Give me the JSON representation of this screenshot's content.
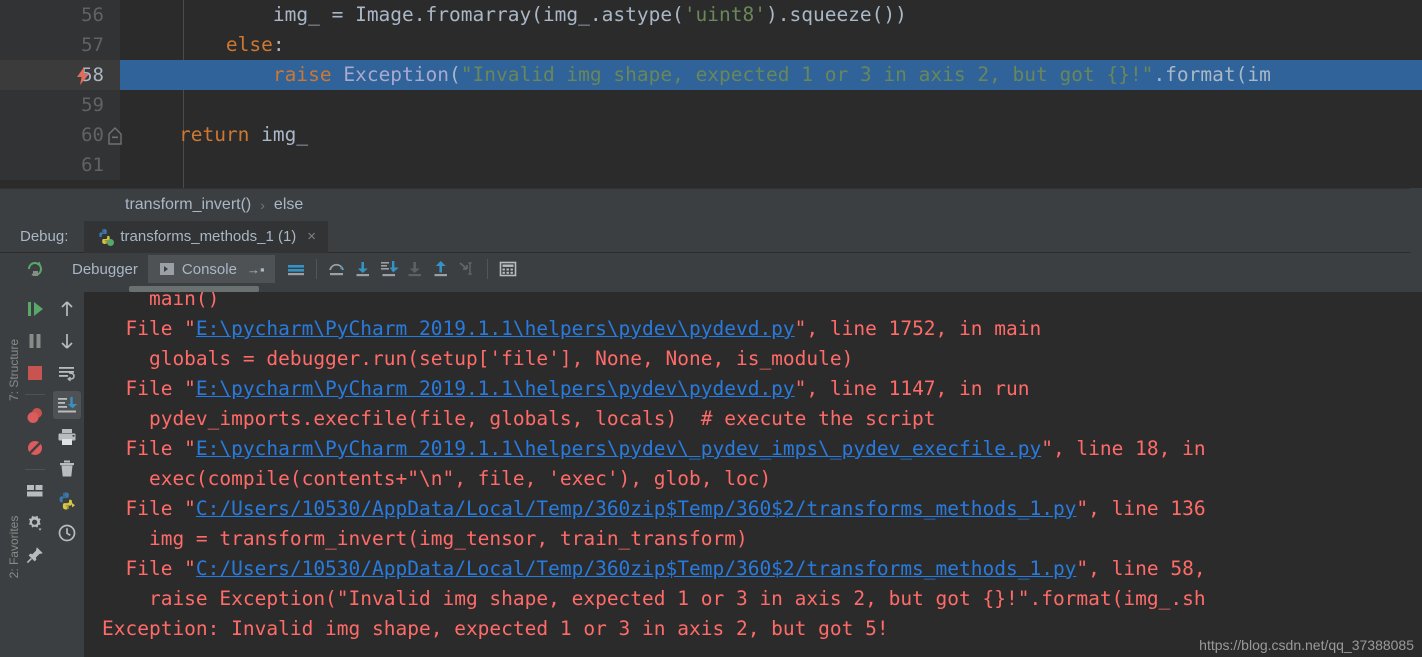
{
  "editor": {
    "lines": [
      {
        "num": "56",
        "marker": "",
        "fold": false,
        "selected": false,
        "tokens": [
          {
            "t": "            ",
            "c": "pln"
          },
          {
            "t": "img_ ",
            "c": "pln"
          },
          {
            "t": "= ",
            "c": "pln"
          },
          {
            "t": "Image.fromarray(img_.astype(",
            "c": "pln"
          },
          {
            "t": "'uint8'",
            "c": "str"
          },
          {
            "t": ").squeeze())",
            "c": "pln"
          }
        ]
      },
      {
        "num": "57",
        "marker": "",
        "fold": false,
        "selected": false,
        "tokens": [
          {
            "t": "        ",
            "c": "pln"
          },
          {
            "t": "else",
            "c": "kw"
          },
          {
            "t": ":",
            "c": "pln"
          }
        ]
      },
      {
        "num": "58",
        "marker": "exception-breakpoint",
        "fold": false,
        "selected": true,
        "tokens": [
          {
            "t": "            ",
            "c": "pln"
          },
          {
            "t": "raise ",
            "c": "kw"
          },
          {
            "t": "Exception",
            "c": "cls"
          },
          {
            "t": "(",
            "c": "pln"
          },
          {
            "t": "\"Invalid img shape, expected 1 or 3 in axis 2, but got {}!\"",
            "c": "str"
          },
          {
            "t": ".format(im",
            "c": "pln"
          }
        ]
      },
      {
        "num": "59",
        "marker": "",
        "fold": false,
        "selected": false,
        "tokens": []
      },
      {
        "num": "60",
        "marker": "",
        "fold": true,
        "selected": false,
        "tokens": [
          {
            "t": "    ",
            "c": "pln"
          },
          {
            "t": "return ",
            "c": "kw"
          },
          {
            "t": "img_",
            "c": "pln"
          }
        ]
      },
      {
        "num": "61",
        "marker": "",
        "fold": false,
        "selected": false,
        "tokens": []
      }
    ]
  },
  "breadcrumb": {
    "items": [
      "transform_invert()",
      "else"
    ],
    "separator": "›"
  },
  "debug_tabbar": {
    "label": "Debug:",
    "tab_title": "transforms_methods_1 (1)",
    "close_glyph": "×",
    "python_icon": "python-icon"
  },
  "debug_toolbar": {
    "rerun_icon": "rerun-icon",
    "tabs": [
      {
        "label": "Debugger",
        "active": false,
        "icon": ""
      },
      {
        "label": "Console",
        "active": true,
        "icon": "console-icon"
      }
    ],
    "console_pin_glyph": "→▪",
    "buttons": [
      {
        "name": "show-execution-point-icon",
        "enabled": true
      },
      {
        "name": "step-over-icon",
        "enabled": true
      },
      {
        "name": "step-into-icon",
        "enabled": true
      },
      {
        "name": "step-into-my-code-icon",
        "enabled": true
      },
      {
        "name": "force-step-into-icon",
        "enabled": false
      },
      {
        "name": "step-out-icon",
        "enabled": true
      },
      {
        "name": "run-to-cursor-icon",
        "enabled": false
      },
      {
        "name": "evaluate-expression-icon",
        "enabled": true
      }
    ]
  },
  "left_rail_labels": [
    "7: Structure",
    "2: Favorites"
  ],
  "debug_actions": [
    {
      "name": "resume-program-icon",
      "color": "#4f9e4f",
      "active": false
    },
    {
      "name": "pause-program-icon",
      "color": "#888888",
      "active": false
    },
    {
      "name": "stop-program-icon",
      "color": "#c75450",
      "active": false
    },
    {
      "name": "view-breakpoints-icon",
      "color": "#db5c5c",
      "active": false
    },
    {
      "name": "mute-breakpoints-icon",
      "color": "#db5c5c",
      "active": false
    },
    {
      "name": "restore-layout-icon",
      "color": "#a9b7c6",
      "active": false
    },
    {
      "name": "settings-gear-icon",
      "color": "#a9b7c6",
      "active": false
    },
    {
      "name": "pin-tab-icon",
      "color": "#a9b7c6",
      "active": false
    }
  ],
  "console_actions": [
    {
      "name": "up-the-stack-icon",
      "active": false
    },
    {
      "name": "down-the-stack-icon",
      "active": false
    },
    {
      "name": "use-soft-wraps-icon",
      "active": false
    },
    {
      "name": "scroll-to-end-icon",
      "active": true
    },
    {
      "name": "print-icon",
      "active": false
    },
    {
      "name": "clear-all-icon",
      "active": false
    },
    {
      "name": "python-console-icon",
      "active": false
    },
    {
      "name": "command-history-icon",
      "active": false
    }
  ],
  "console": {
    "scrollbar": "horizontal-scrollbar",
    "lines": [
      {
        "segments": [
          {
            "t": "    main()",
            "k": "text"
          }
        ],
        "clipped_top": true
      },
      {
        "segments": [
          {
            "t": "  File \"",
            "k": "text"
          },
          {
            "t": "E:\\pycharm\\PyCharm 2019.1.1\\helpers\\pydev\\pydevd.py",
            "k": "link"
          },
          {
            "t": "\", line 1752, in main",
            "k": "text"
          }
        ]
      },
      {
        "segments": [
          {
            "t": "    globals = debugger.run(setup['file'], None, None, is_module)",
            "k": "text"
          }
        ]
      },
      {
        "segments": [
          {
            "t": "  File \"",
            "k": "text"
          },
          {
            "t": "E:\\pycharm\\PyCharm 2019.1.1\\helpers\\pydev\\pydevd.py",
            "k": "link"
          },
          {
            "t": "\", line 1147, in run",
            "k": "text"
          }
        ]
      },
      {
        "segments": [
          {
            "t": "    pydev_imports.execfile(file, globals, locals)  # execute the script",
            "k": "text"
          }
        ]
      },
      {
        "segments": [
          {
            "t": "  File \"",
            "k": "text"
          },
          {
            "t": "E:\\pycharm\\PyCharm 2019.1.1\\helpers\\pydev\\_pydev_imps\\_pydev_execfile.py",
            "k": "link"
          },
          {
            "t": "\", line 18, in",
            "k": "text"
          }
        ]
      },
      {
        "segments": [
          {
            "t": "    exec(compile(contents+\"\\n\", file, 'exec'), glob, loc)",
            "k": "text"
          }
        ]
      },
      {
        "segments": [
          {
            "t": "  File \"",
            "k": "text"
          },
          {
            "t": "C:/Users/10530/AppData/Local/Temp/360zip$Temp/360$2/transforms_methods_1.py",
            "k": "link"
          },
          {
            "t": "\", line 136",
            "k": "text"
          }
        ]
      },
      {
        "segments": [
          {
            "t": "    img = transform_invert(img_tensor, train_transform)",
            "k": "text"
          }
        ]
      },
      {
        "segments": [
          {
            "t": "  File \"",
            "k": "text"
          },
          {
            "t": "C:/Users/10530/AppData/Local/Temp/360zip$Temp/360$2/transforms_methods_1.py",
            "k": "link"
          },
          {
            "t": "\", line 58,",
            "k": "text"
          }
        ]
      },
      {
        "segments": [
          {
            "t": "    raise Exception(\"Invalid img shape, expected 1 or 3 in axis 2, but got {}!\".format(img_.sh",
            "k": "text"
          }
        ]
      },
      {
        "segments": [
          {
            "t": "Exception: Invalid img shape, expected 1 or 3 in axis 2, but got 5!",
            "k": "text"
          }
        ]
      }
    ]
  },
  "watermark": "https://blog.csdn.net/qq_37388085",
  "colors": {
    "editor_bg": "#2b2b2b",
    "gutter_bg": "#313335",
    "panel_bg": "#3c3f41",
    "selection_blue": "#2f6399",
    "error_red": "#ff6b68",
    "link_blue": "#287bde",
    "string_green": "#6a8759",
    "keyword_orange": "#cc7832",
    "text_fg": "#a9b7c6"
  }
}
